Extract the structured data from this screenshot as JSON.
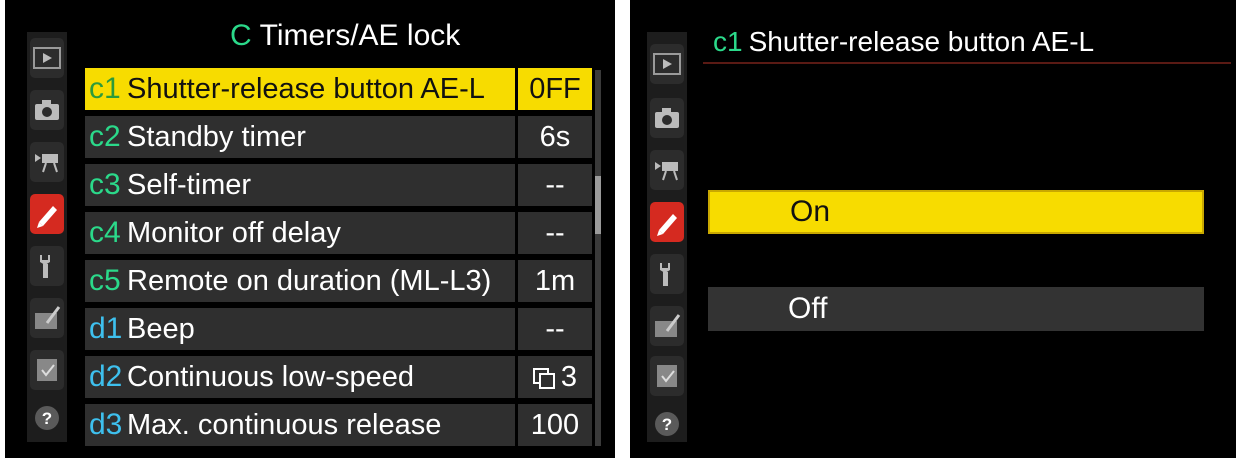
{
  "left_screen": {
    "title_code": "C",
    "title": "Timers/AE lock",
    "items": [
      {
        "code": "c1",
        "label": "Shutter-release button AE-L",
        "value": "0FF",
        "selected": true
      },
      {
        "code": "c2",
        "label": "Standby timer",
        "value": "6s"
      },
      {
        "code": "c3",
        "label": "Self-timer",
        "value": "--"
      },
      {
        "code": "c4",
        "label": "Monitor off delay",
        "value": "--"
      },
      {
        "code": "c5",
        "label": "Remote on duration (ML-L3)",
        "value": "1m"
      },
      {
        "code": "d1",
        "label": "Beep",
        "value": "--"
      },
      {
        "code": "d2",
        "label": "Continuous low-speed",
        "value": "3",
        "value_icon": "burst-mode-icon"
      },
      {
        "code": "d3",
        "label": "Max. continuous release",
        "value": "100"
      }
    ]
  },
  "right_screen": {
    "title_code": "c1",
    "title": "Shutter-release button AE-L",
    "options": [
      {
        "label": "On",
        "selected": true
      },
      {
        "label": "Off",
        "selected": false
      }
    ]
  },
  "sidebar_tabs": [
    {
      "icon": "playback-icon"
    },
    {
      "icon": "camera-icon"
    },
    {
      "icon": "movie-icon"
    },
    {
      "icon": "pencil-icon",
      "active": true
    },
    {
      "icon": "wrench-icon"
    },
    {
      "icon": "retouch-icon"
    },
    {
      "icon": "my-menu-icon"
    },
    {
      "icon": "help-icon",
      "text": "?"
    }
  ],
  "colors": {
    "highlight": "#f7dc00",
    "code_green": "#2bd98a",
    "code_blue": "#3ec0ee",
    "active_tab": "#d52a20",
    "row_bg": "#2f2f2f"
  }
}
